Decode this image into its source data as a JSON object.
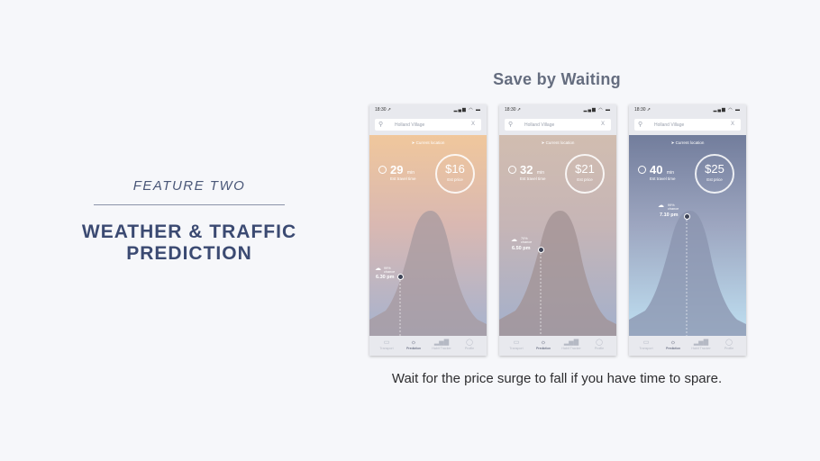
{
  "slide": {
    "feature_label": "FEATURE  TWO",
    "title_line1": "WEATHER & TRAFFIC",
    "title_line2": "PREDICTION",
    "section_title": "Save by Waiting",
    "caption": "Wait for the price surge to fall if you have time to spare."
  },
  "phones": [
    {
      "status_time": "18:30 ➚",
      "status_icons": "▂▄▆ ◠ ▬",
      "search_value": "Holland Village",
      "clear": "X",
      "current_location": "➤  Current location",
      "minutes": "29",
      "minutes_unit": "min",
      "travel_label": "Est travel time",
      "price": "$16",
      "price_label": "Est price",
      "rain_chance": "99% chance",
      "predicted_time": "6.30 pm",
      "weather_icon": "cloud-rain-icon",
      "colors": {
        "top": "#f0c79c",
        "mid": "#d9b8b2",
        "bottom": "#a6b3cf",
        "mountain": "#a79a9f"
      },
      "tabs": [
        {
          "icon": "bus-icon",
          "label": "Transport"
        },
        {
          "icon": "sun-icon",
          "label": "Prediction"
        },
        {
          "icon": "chart-icon",
          "label": "Habit Tracker"
        },
        {
          "icon": "profile-icon",
          "label": "Profile"
        }
      ],
      "active_tab": "Prediction"
    },
    {
      "status_time": "18:30 ➚",
      "status_icons": "▂▄▆ ◠ ▬",
      "search_value": "Holland Village",
      "clear": "X",
      "current_location": "➤  Current location",
      "minutes": "32",
      "minutes_unit": "min",
      "travel_label": "Est travel time",
      "price": "$21",
      "price_label": "Est price",
      "rain_chance": "70% chance",
      "predicted_time": "6.50 pm",
      "weather_icon": "cloud-rain-icon",
      "colors": {
        "top": "#d1bdb0",
        "mid": "#c6b5b6",
        "bottom": "#a3b0cc",
        "mountain": "#a19193"
      },
      "tabs": [
        {
          "icon": "bus-icon",
          "label": "Transport"
        },
        {
          "icon": "sun-icon",
          "label": "Prediction"
        },
        {
          "icon": "chart-icon",
          "label": "Habit Tracker"
        },
        {
          "icon": "profile-icon",
          "label": "Profile"
        }
      ],
      "active_tab": "Prediction"
    },
    {
      "status_time": "18:30 ➚",
      "status_icons": "▂▄▆ ◠ ▬",
      "search_value": "Holland Village",
      "clear": "X",
      "current_location": "➤  Current location",
      "minutes": "40",
      "minutes_unit": "min",
      "travel_label": "Est travel time",
      "price": "$25",
      "price_label": "Est price",
      "rain_chance": "99% chance",
      "predicted_time": "7.10 pm",
      "weather_icon": "cloud-storm-icon",
      "colors": {
        "top": "#727d9c",
        "mid": "#9da6c0",
        "bottom": "#bfe0f2",
        "mountain": "#8a93ad"
      },
      "tabs": [
        {
          "icon": "bus-icon",
          "label": "Transport"
        },
        {
          "icon": "sun-icon",
          "label": "Prediction"
        },
        {
          "icon": "chart-icon",
          "label": "Habit Tracker"
        },
        {
          "icon": "profile-icon",
          "label": "Profile"
        }
      ],
      "active_tab": "Prediction"
    }
  ]
}
